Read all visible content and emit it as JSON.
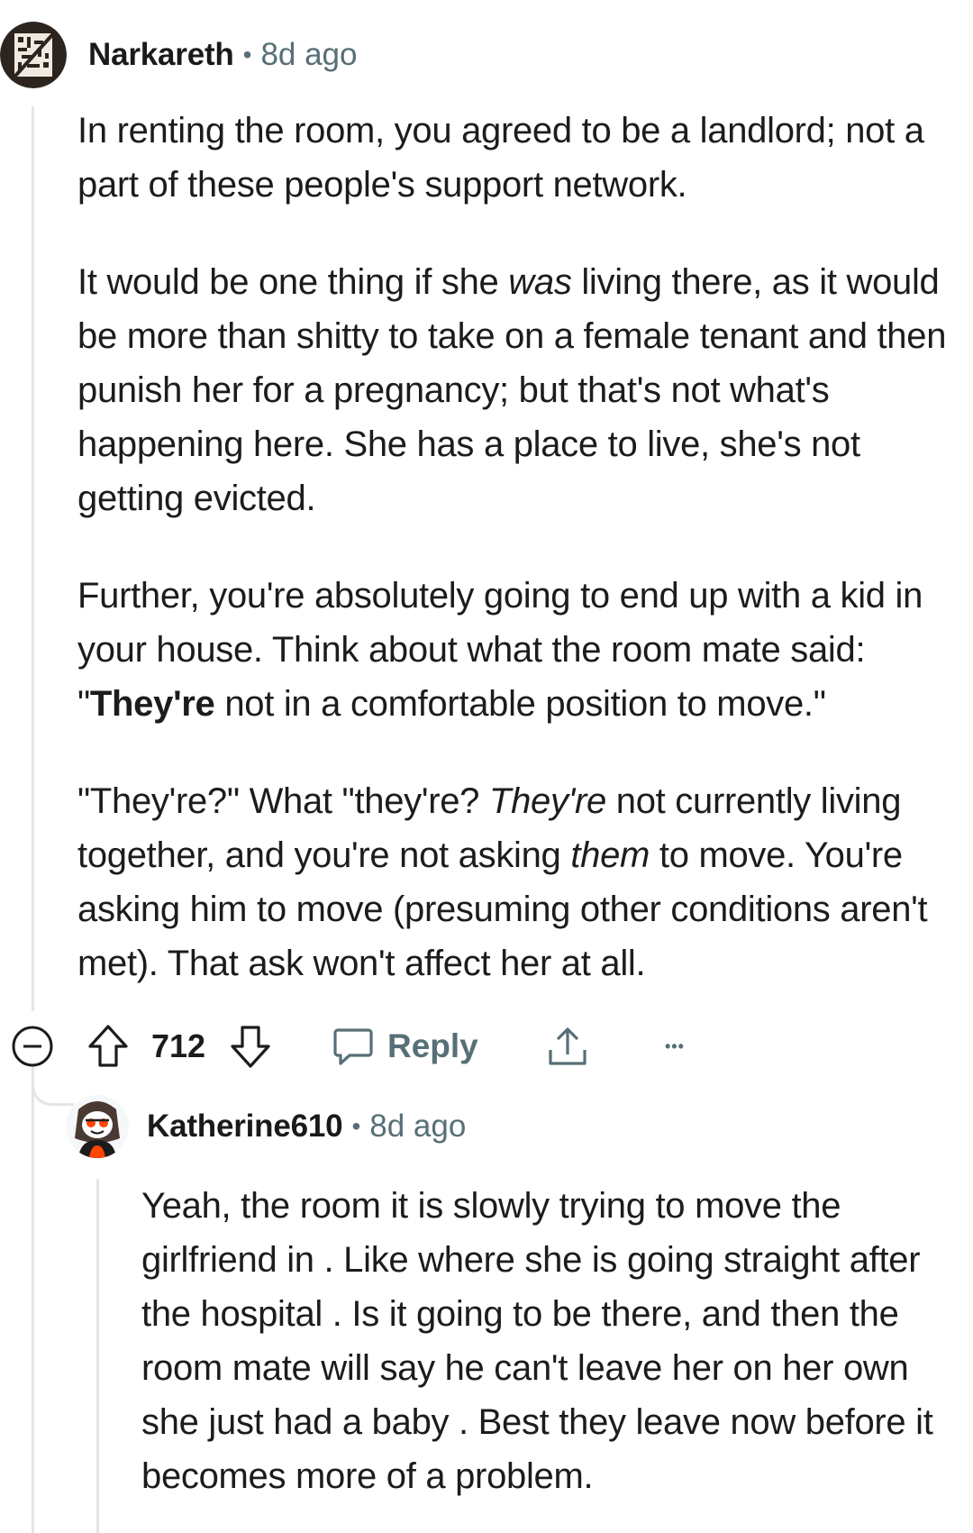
{
  "comment": {
    "author": "Narkareth",
    "separator": "•",
    "time": "8d ago",
    "paragraphs": {
      "p1": {
        "text": "In renting the room, you agreed to be a landlord; not a part of these people's support network."
      },
      "p2": {
        "before": "It would be one thing if she ",
        "em": "was",
        "after": " living there, as it would be more than shitty to take on a female tenant and then punish her for a pregnancy; but that's not what's happening here. She has a place to live, she's not getting evicted."
      },
      "p3": {
        "before": "Further, you're absolutely going to end up with a kid in your house. Think about what the room mate said: \"",
        "strong": "They're",
        "after": " not in a comfortable position to move.\""
      },
      "p4": {
        "a": "\"They're?\" What \"they're? ",
        "em1": "They're",
        "b": " not currently living together, and you're not asking ",
        "em2": "them",
        "c": " to move. You're asking him to move (presuming other conditions aren't met). That ask won't affect her at all."
      }
    },
    "actions": {
      "score": "712",
      "reply_label": "Reply",
      "more": "•••"
    }
  },
  "reply": {
    "author": "Katherine610",
    "separator": "•",
    "time": "8d ago",
    "text": "Yeah, the room it is slowly trying to move the girlfriend in . Like where she is going straight after the hospital . Is it going to be there, and then the room mate will say he can't leave her on her own she just had a baby . Best they leave now before it becomes more of a problem."
  },
  "colors": {
    "text": "#1c1c1c",
    "meta": "#576f76",
    "thread_line": "#e5e5e5",
    "avatar_accent": "#ff4500"
  },
  "icons": {
    "collapse": "collapse-minus-icon",
    "upvote": "upvote-arrow-icon",
    "downvote": "downvote-arrow-icon",
    "reply": "reply-bubble-icon",
    "share": "share-icon",
    "more": "more-options-icon"
  }
}
